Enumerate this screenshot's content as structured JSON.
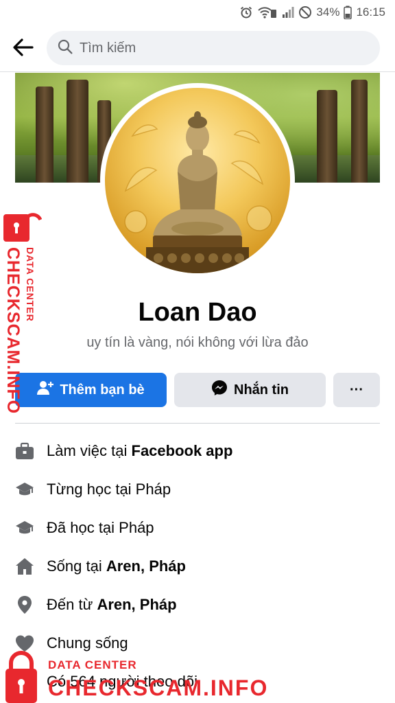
{
  "status_bar": {
    "battery": "34%",
    "time": "16:15",
    "icons": [
      "alarm-icon",
      "wifi-call-icon",
      "signal-icon",
      "do-not-disturb-icon",
      "battery-icon"
    ]
  },
  "header": {
    "back_icon": "arrow-left-icon",
    "search_icon": "search-icon",
    "search_placeholder": "Tìm kiếm"
  },
  "profile": {
    "name": "Loan Dao",
    "bio": "uy tín là vàng, nói không với lừa đảo",
    "avatar_description_icon": "avatar-image"
  },
  "actions": {
    "add_friend_label": "Thêm bạn bè",
    "message_label": "Nhắn tin",
    "more_label": "···"
  },
  "info": [
    {
      "icon": "briefcase-icon",
      "prefix": "Làm việc tại ",
      "bold": "Facebook app"
    },
    {
      "icon": "graduation-cap-icon",
      "prefix": "Từng học tại Pháp",
      "bold": ""
    },
    {
      "icon": "graduation-cap-icon",
      "prefix": "Đã học tại Pháp",
      "bold": ""
    },
    {
      "icon": "home-icon",
      "prefix": "Sống tại ",
      "bold": "Aren, Pháp"
    },
    {
      "icon": "location-pin-icon",
      "prefix": "Đến từ ",
      "bold": "Aren, Pháp"
    },
    {
      "icon": "heart-icon",
      "prefix": "Chung sống",
      "bold": ""
    },
    {
      "icon": "rss-icon",
      "prefix": "Có 564 người theo dõi",
      "bold": ""
    }
  ],
  "watermark": {
    "side_small": "DATA CENTER",
    "side_large": "CHECKSCAM.INFO",
    "bottom_small": "DATA CENTER",
    "bottom_large": "CHECKSCAM.INFO",
    "color": "#e8282e"
  },
  "colors": {
    "accent": "#1b74e4",
    "secondary_button": "#e4e6eb",
    "muted_text": "#65676b"
  }
}
